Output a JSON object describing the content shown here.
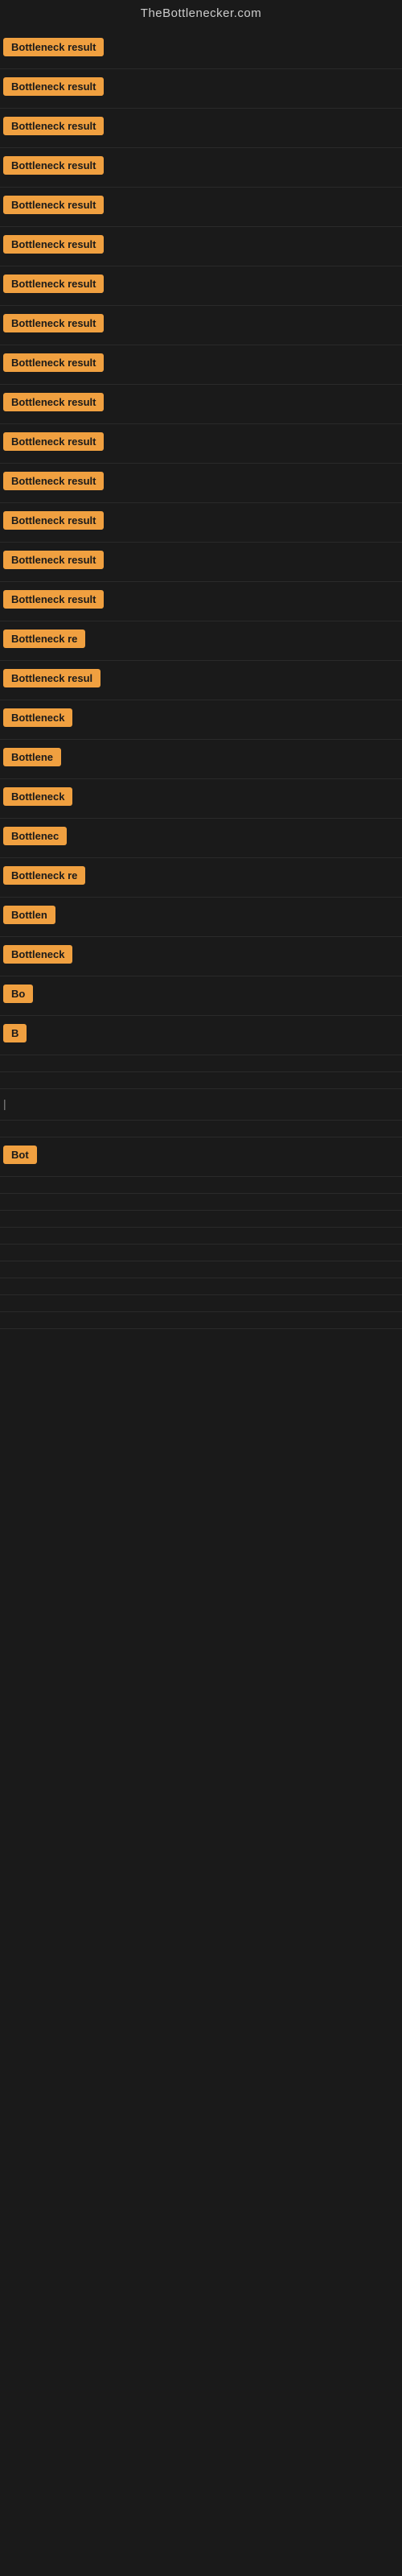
{
  "header": {
    "title": "TheBottlenecker.com"
  },
  "rows": [
    {
      "label": "Bottleneck result",
      "width": 145
    },
    {
      "label": "Bottleneck result",
      "width": 145
    },
    {
      "label": "Bottleneck result",
      "width": 145
    },
    {
      "label": "Bottleneck result",
      "width": 145
    },
    {
      "label": "Bottleneck result",
      "width": 145
    },
    {
      "label": "Bottleneck result",
      "width": 145
    },
    {
      "label": "Bottleneck result",
      "width": 145
    },
    {
      "label": "Bottleneck result",
      "width": 145
    },
    {
      "label": "Bottleneck result",
      "width": 145
    },
    {
      "label": "Bottleneck result",
      "width": 145
    },
    {
      "label": "Bottleneck result",
      "width": 145
    },
    {
      "label": "Bottleneck result",
      "width": 145
    },
    {
      "label": "Bottleneck result",
      "width": 145
    },
    {
      "label": "Bottleneck result",
      "width": 145
    },
    {
      "label": "Bottleneck result",
      "width": 145
    },
    {
      "label": "Bottleneck re",
      "width": 110
    },
    {
      "label": "Bottleneck resul",
      "width": 125
    },
    {
      "label": "Bottleneck",
      "width": 85
    },
    {
      "label": "Bottlene",
      "width": 72
    },
    {
      "label": "Bottleneck",
      "width": 85
    },
    {
      "label": "Bottlenec",
      "width": 78
    },
    {
      "label": "Bottleneck re",
      "width": 110
    },
    {
      "label": "Bottlen",
      "width": 65
    },
    {
      "label": "Bottleneck",
      "width": 85
    },
    {
      "label": "Bo",
      "width": 28
    },
    {
      "label": "B",
      "width": 16
    },
    {
      "label": "",
      "width": 0
    },
    {
      "label": "",
      "width": 0
    },
    {
      "label": "|",
      "width": 8
    },
    {
      "label": "",
      "width": 0
    },
    {
      "label": "Bot",
      "width": 32
    },
    {
      "label": "",
      "width": 0
    },
    {
      "label": "",
      "width": 0
    },
    {
      "label": "",
      "width": 0
    },
    {
      "label": "",
      "width": 0
    },
    {
      "label": "",
      "width": 0
    },
    {
      "label": "",
      "width": 0
    },
    {
      "label": "",
      "width": 0
    },
    {
      "label": "",
      "width": 0
    },
    {
      "label": "",
      "width": 0
    }
  ]
}
